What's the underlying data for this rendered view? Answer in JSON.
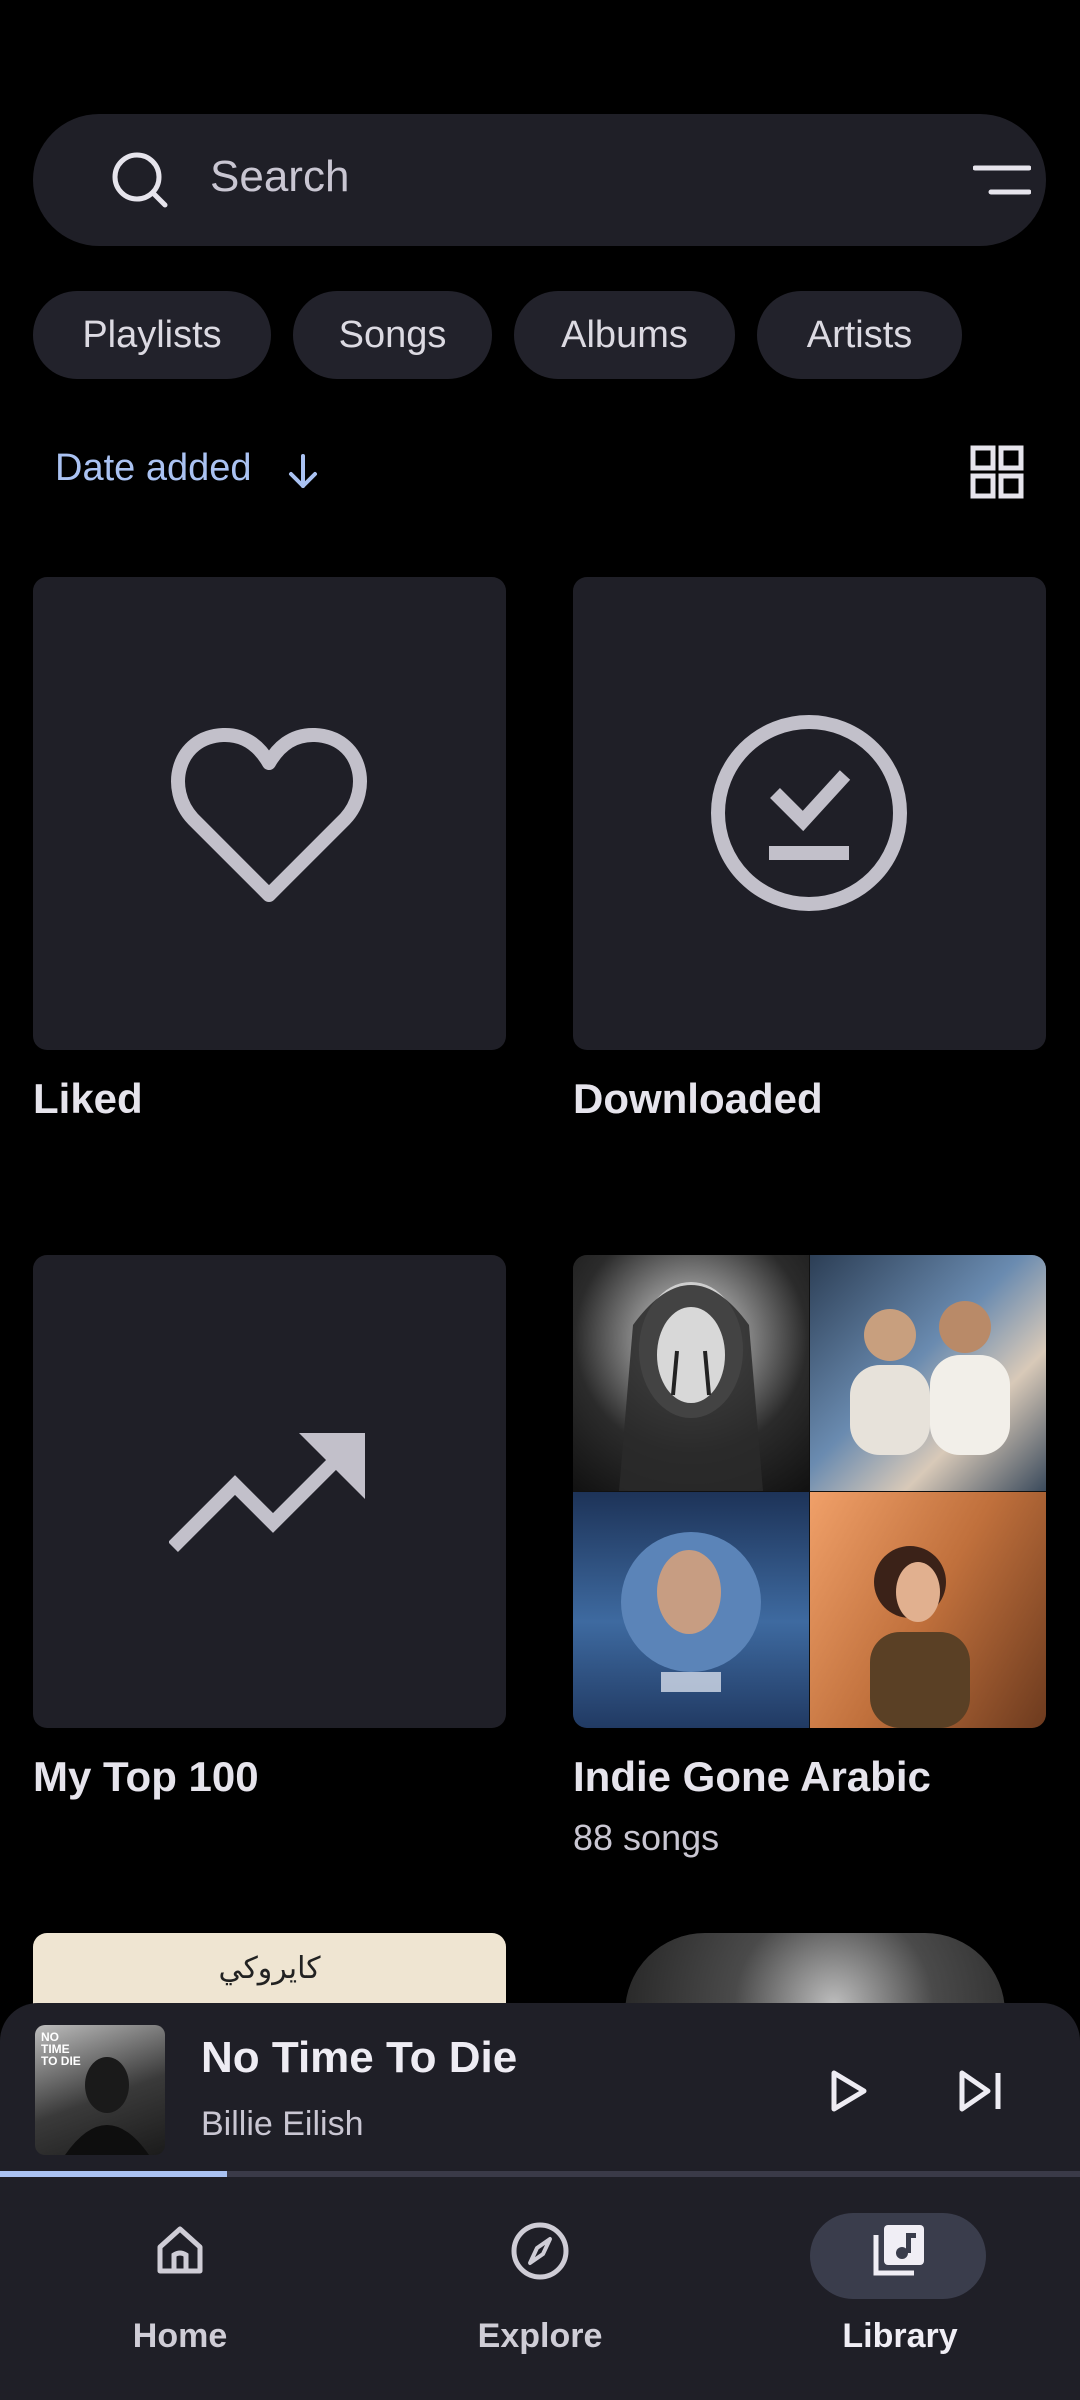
{
  "search": {
    "placeholder": "Search",
    "icon": "search-icon",
    "filter_icon": "filter-icon"
  },
  "chips": [
    {
      "label": "Playlists"
    },
    {
      "label": "Songs"
    },
    {
      "label": "Albums"
    },
    {
      "label": "Artists"
    }
  ],
  "sort": {
    "label": "Date added",
    "direction_icon": "arrow-down-icon",
    "view_icon": "grid-view-icon"
  },
  "library": [
    {
      "title": "Liked",
      "icon": "heart-icon"
    },
    {
      "title": "Downloaded",
      "icon": "download-done-icon"
    },
    {
      "title": "My Top 100",
      "icon": "trending-up-icon"
    },
    {
      "title": "Indie Gone Arabic",
      "subtitle": "88 songs"
    }
  ],
  "partial_tile_text": "كايروكي",
  "now_playing": {
    "title": "No Time To Die",
    "artist": "Billie Eilish",
    "art_text": "NO TIME TO DIE",
    "progress": 0.21
  },
  "nav": [
    {
      "label": "Home",
      "icon": "home-icon"
    },
    {
      "label": "Explore",
      "icon": "compass-icon"
    },
    {
      "label": "Library",
      "icon": "library-music-icon",
      "active": true
    }
  ],
  "colors": {
    "accent": "#aac2f2",
    "surface": "#1f1f27",
    "background": "#000000"
  }
}
